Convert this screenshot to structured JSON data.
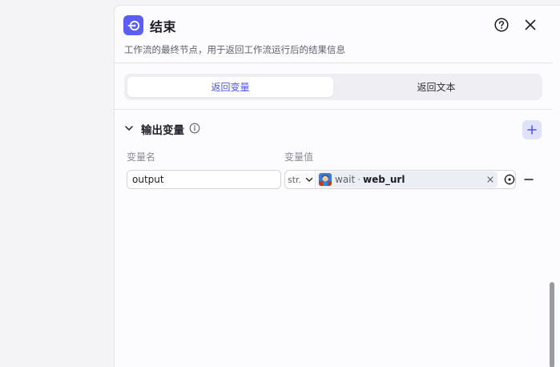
{
  "header": {
    "title": "结束",
    "description": "工作流的最终节点，用于返回工作流运行后的结果信息",
    "icons": {
      "node": "end-node-icon",
      "help": "help-circle-icon",
      "close": "close-icon"
    },
    "accent_color": "#5b5ef0"
  },
  "tabs": [
    {
      "label": "返回变量",
      "active": true
    },
    {
      "label": "返回文本",
      "active": false
    }
  ],
  "output_section": {
    "title": "输出变量",
    "column_name_label": "变量名",
    "column_value_label": "变量值",
    "rows": [
      {
        "name": "output",
        "type_label": "str.",
        "ref_node": "wait",
        "ref_separator": "·",
        "ref_variable": "web_url",
        "clear_label": "×"
      }
    ]
  }
}
